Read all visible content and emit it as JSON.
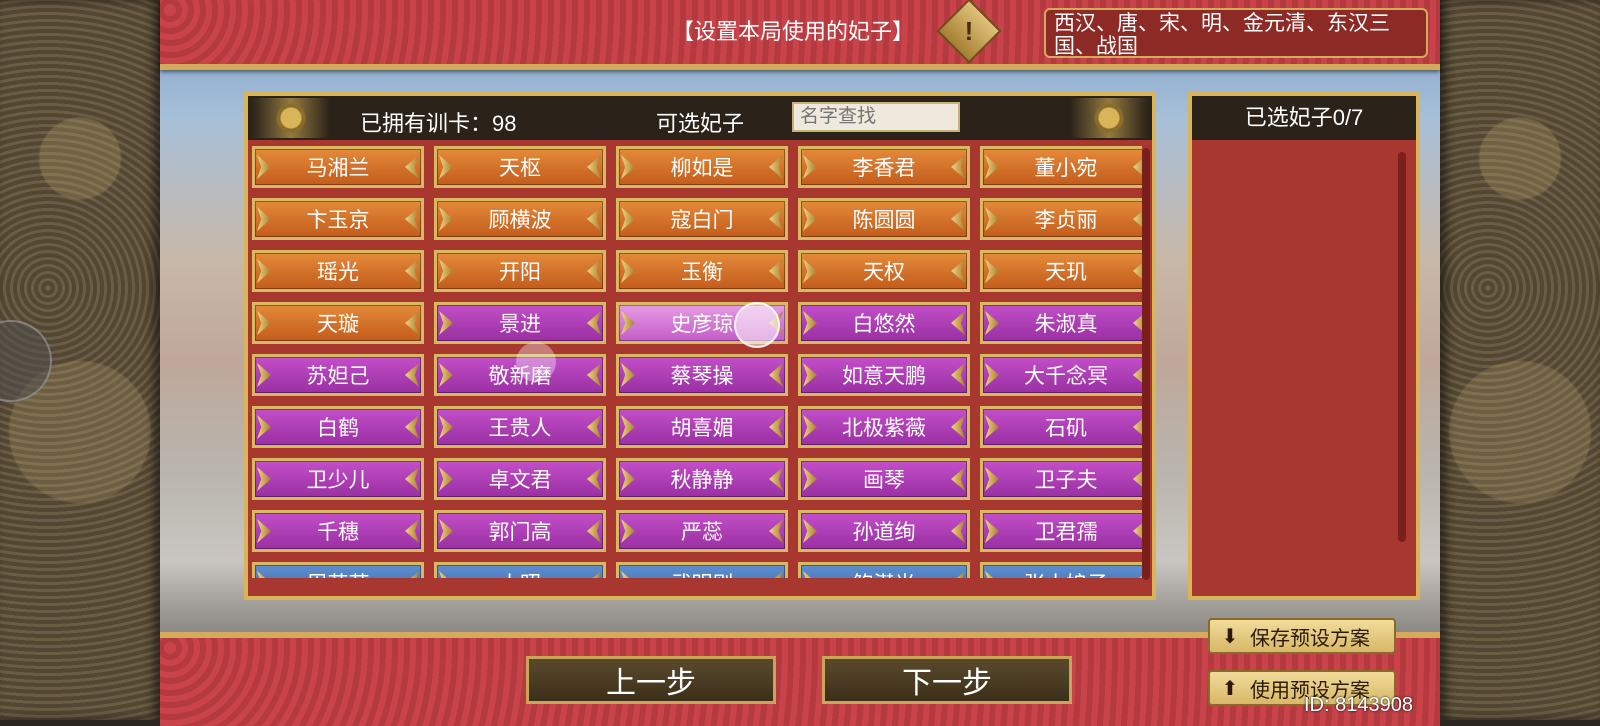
{
  "header": {
    "title": "【设置本局使用的妃子】",
    "warning_icon": "!",
    "dynasties": "西汉、唐、宋、明、金元清、东汉三国、战国"
  },
  "list_panel": {
    "owned_label": "已拥有训卡：98",
    "available_label": "可选妃子",
    "search_placeholder": "名字查找",
    "concubines": [
      {
        "name": "马湘兰",
        "tier": "orange"
      },
      {
        "name": "天枢",
        "tier": "orange"
      },
      {
        "name": "柳如是",
        "tier": "orange"
      },
      {
        "name": "李香君",
        "tier": "orange"
      },
      {
        "name": "董小宛",
        "tier": "orange"
      },
      {
        "name": "卞玉京",
        "tier": "orange"
      },
      {
        "name": "顾横波",
        "tier": "orange"
      },
      {
        "name": "寇白门",
        "tier": "orange"
      },
      {
        "name": "陈圆圆",
        "tier": "orange"
      },
      {
        "name": "李贞丽",
        "tier": "orange"
      },
      {
        "name": "瑶光",
        "tier": "orange"
      },
      {
        "name": "开阳",
        "tier": "orange"
      },
      {
        "name": "玉衡",
        "tier": "orange"
      },
      {
        "name": "天权",
        "tier": "orange"
      },
      {
        "name": "天玑",
        "tier": "orange"
      },
      {
        "name": "天璇",
        "tier": "orange"
      },
      {
        "name": "景进",
        "tier": "purple"
      },
      {
        "name": "史彦琼",
        "tier": "highlight"
      },
      {
        "name": "白悠然",
        "tier": "purple"
      },
      {
        "name": "朱淑真",
        "tier": "purple"
      },
      {
        "name": "苏妲己",
        "tier": "purple"
      },
      {
        "name": "敬新磨",
        "tier": "purple"
      },
      {
        "name": "蔡琴操",
        "tier": "purple"
      },
      {
        "name": "如意天鹏",
        "tier": "purple"
      },
      {
        "name": "大千念冥",
        "tier": "purple"
      },
      {
        "name": "白鹤",
        "tier": "purple"
      },
      {
        "name": "王贵人",
        "tier": "purple"
      },
      {
        "name": "胡喜媚",
        "tier": "purple"
      },
      {
        "name": "北极紫薇",
        "tier": "purple"
      },
      {
        "name": "石矶",
        "tier": "purple"
      },
      {
        "name": "卫少儿",
        "tier": "purple"
      },
      {
        "name": "卓文君",
        "tier": "purple"
      },
      {
        "name": "秋静静",
        "tier": "purple"
      },
      {
        "name": "画琴",
        "tier": "purple"
      },
      {
        "name": "卫子夫",
        "tier": "purple"
      },
      {
        "name": "千穗",
        "tier": "purple"
      },
      {
        "name": "郭门高",
        "tier": "purple"
      },
      {
        "name": "严蕊",
        "tier": "purple"
      },
      {
        "name": "孙道绚",
        "tier": "purple"
      },
      {
        "name": "卫君孺",
        "tier": "purple"
      },
      {
        "name": "周芷若",
        "tier": "blue"
      },
      {
        "name": "小昭",
        "tier": "blue"
      },
      {
        "name": "武明则",
        "tier": "blue"
      },
      {
        "name": "鲍潜光",
        "tier": "blue"
      },
      {
        "name": "张小娘子",
        "tier": "blue"
      }
    ]
  },
  "selected_panel": {
    "title": "已选妃子0/7"
  },
  "footer": {
    "prev_label": "上一步",
    "next_label": "下一步",
    "save_preset_label": "保存预设方案",
    "use_preset_label": "使用预设方案",
    "user_id": "ID: 8143908"
  },
  "colors": {
    "orange_card": "#d9772d",
    "purple_card": "#b03fb8",
    "blue_card": "#4a7bbd",
    "gold_border": "#d9b55a",
    "panel_red": "#a8372f"
  }
}
